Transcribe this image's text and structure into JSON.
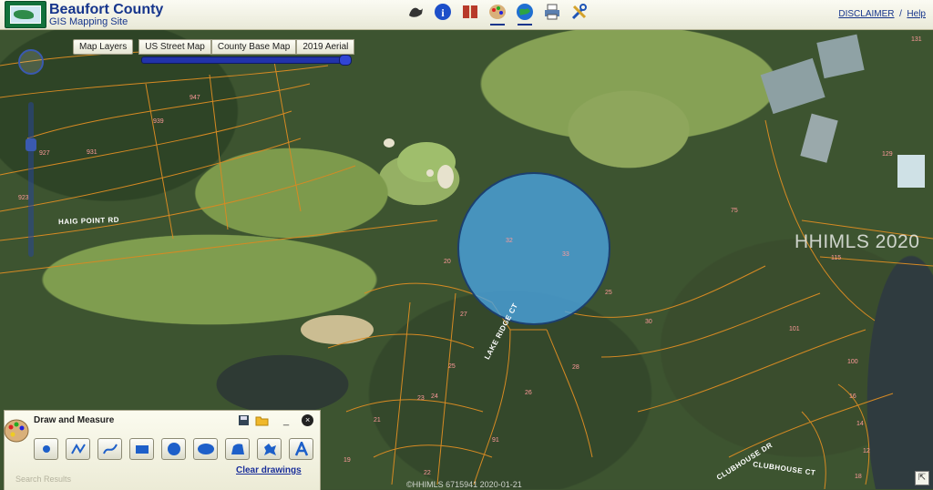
{
  "header": {
    "title": "Beaufort County",
    "subtitle": "GIS Mapping Site",
    "disclaimer_label": "DISCLAIMER",
    "help_label": "Help",
    "separator": "/",
    "toolbar_icons": [
      "tracks-icon",
      "info-icon",
      "book-icon",
      "palette-icon",
      "globe-icon",
      "printer-icon",
      "tools-icon"
    ]
  },
  "map": {
    "layers_button": "Map Layers",
    "base_maps": [
      "US Street Map",
      "County Base Map",
      "2019 Aerial"
    ],
    "watermark": "HHIMLS 2020",
    "bottom_watermark": "©HHIMLS  6715941 2020-01-21",
    "roads": {
      "haig_point": "HAIG POINT RD",
      "lake_ridge": "LAKE RIDGE CT",
      "clubhouse_dr": "CLUBHOUSE DR",
      "clubhouse_ct": "CLUBHOUSE CT"
    },
    "parcel_labels": [
      "947",
      "939",
      "931",
      "927",
      "923",
      "20",
      "27",
      "25",
      "24",
      "23",
      "21",
      "22",
      "19",
      "26",
      "28",
      "30",
      "33",
      "32",
      "25",
      "91",
      "115",
      "101",
      "100",
      "16",
      "14",
      "12",
      "131",
      "129",
      "18",
      "75"
    ]
  },
  "draw_panel": {
    "title": "Draw and Measure",
    "clear_label": "Clear drawings",
    "search_label": "Search Results",
    "tools": [
      "point-tool",
      "polyline-tool",
      "freehand-line-tool",
      "rectangle-tool",
      "circle-tool",
      "ellipse-tool",
      "freehand-polygon-tool",
      "star-shape-tool",
      "text-tool"
    ],
    "minimize_label": "_",
    "close_label": "×"
  },
  "colors": {
    "accent": "#16358c",
    "circle_fill": "#4aa5e6",
    "parcel_line": "#d68a23"
  }
}
